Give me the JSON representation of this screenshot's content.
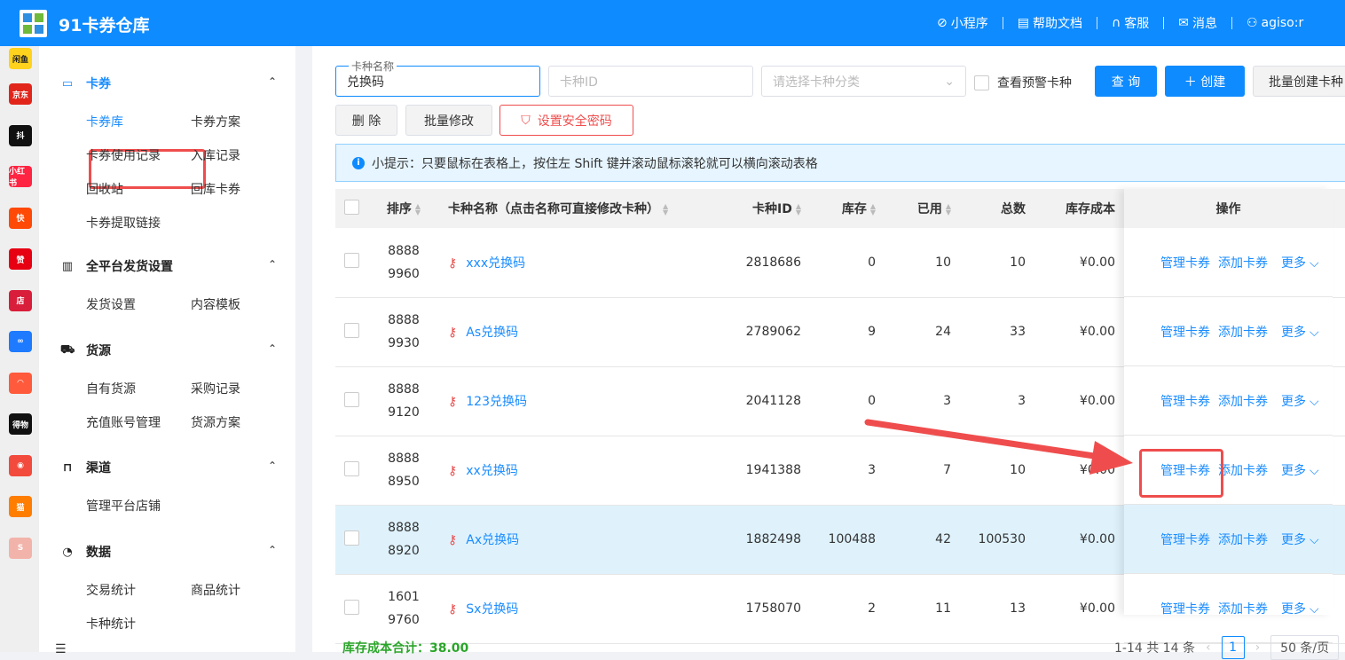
{
  "app": {
    "title": "91卡券仓库"
  },
  "header_nav": [
    {
      "icon": "mini-program-icon",
      "label": "小程序"
    },
    {
      "icon": "document-icon",
      "label": "帮助文档"
    },
    {
      "icon": "headset-icon",
      "label": "客服"
    },
    {
      "icon": "mail-icon",
      "label": "消息"
    },
    {
      "icon": "user-icon",
      "label": "agiso:r"
    }
  ],
  "app_strip": [
    {
      "label": "闲鱼",
      "color": "#ffd21e"
    },
    {
      "label": "京东",
      "color": "#e1251b"
    },
    {
      "label": "抖",
      "color": "#111111"
    },
    {
      "label": "小红书",
      "color": "#ff2442"
    },
    {
      "label": "快",
      "color": "#ff4906"
    },
    {
      "label": "赞",
      "color": "#e60012"
    },
    {
      "label": "店",
      "color": "#d81e3a"
    },
    {
      "label": "∞",
      "color": "#1e7bff"
    },
    {
      "label": "◠",
      "color": "#ff5a3c"
    },
    {
      "label": "得物",
      "color": "#111111"
    },
    {
      "label": "◉",
      "color": "#f24a3c"
    },
    {
      "label": "猫",
      "color": "#ff7d00"
    },
    {
      "label": "S",
      "color": "#f2b3aa"
    }
  ],
  "sidebar": {
    "groups": [
      {
        "title": "卡券",
        "icon": "card-icon",
        "items": [
          "卡券库",
          "卡券方案",
          "卡券使用记录",
          "入库记录",
          "回收站",
          "回库卡券",
          "卡券提取链接"
        ]
      },
      {
        "title": "全平台发货设置",
        "icon": "grid-icon",
        "items": [
          "发货设置",
          "内容模板"
        ]
      },
      {
        "title": "货源",
        "icon": "cart-icon",
        "items": [
          "自有货源",
          "采购记录",
          "充值账号管理",
          "货源方案"
        ]
      },
      {
        "title": "渠道",
        "icon": "bag-icon",
        "items": [
          "管理平台店铺"
        ]
      },
      {
        "title": "数据",
        "icon": "pie-icon",
        "items": [
          "交易统计",
          "商品统计",
          "卡种统计"
        ]
      }
    ]
  },
  "filters": {
    "name_label": "卡种名称",
    "name_value": "兑换码",
    "id_placeholder": "卡种ID",
    "category_placeholder": "请选择卡种分类",
    "warning_checkbox": "查看预警卡种",
    "query": "查 询",
    "create": "＋  创建",
    "batch_create": "批量创建卡种",
    "delete": "删 除",
    "batch_edit": "批量修改",
    "security_pwd": "设置安全密码"
  },
  "tip": "小提示：只要鼠标在表格上，按住左 Shift 键并滚动鼠标滚轮就可以横向滚动表格",
  "table": {
    "headers": [
      "排序",
      "卡种名称（点击名称可直接修改卡种）",
      "卡种ID",
      "库存",
      "已用",
      "总数",
      "库存成本",
      "操作"
    ],
    "rows": [
      {
        "sort": "8888\n9960",
        "name": "xxx兑换码",
        "id": "2818686",
        "stock": "0",
        "used": "10",
        "total": "10",
        "cost": "¥0.00"
      },
      {
        "sort": "8888\n9930",
        "name": "As兑换码",
        "id": "2789062",
        "stock": "9",
        "used": "24",
        "total": "33",
        "cost": "¥0.00"
      },
      {
        "sort": "8888\n9120",
        "name": "123兑换码",
        "id": "2041128",
        "stock": "0",
        "used": "3",
        "total": "3",
        "cost": "¥0.00"
      },
      {
        "sort": "8888\n8950",
        "name": "xx兑换码",
        "id": "1941388",
        "stock": "3",
        "used": "7",
        "total": "10",
        "cost": "¥0.00"
      },
      {
        "sort": "8888\n8920",
        "name": "Ax兑换码",
        "id": "1882498",
        "stock": "100488",
        "used": "42",
        "total": "100530",
        "cost": "¥0.00"
      },
      {
        "sort": "1601\n9760",
        "name": "Sx兑换码",
        "id": "1758070",
        "stock": "2",
        "used": "11",
        "total": "13",
        "cost": "¥0.00"
      }
    ],
    "actions": {
      "manage": "管理卡券",
      "add": "添加卡券",
      "more": "更多"
    }
  },
  "footer": {
    "total_cost": "库存成本合计：38.00",
    "range": "1-14 共 14 条",
    "page": "1",
    "page_size": "50 条/页"
  }
}
